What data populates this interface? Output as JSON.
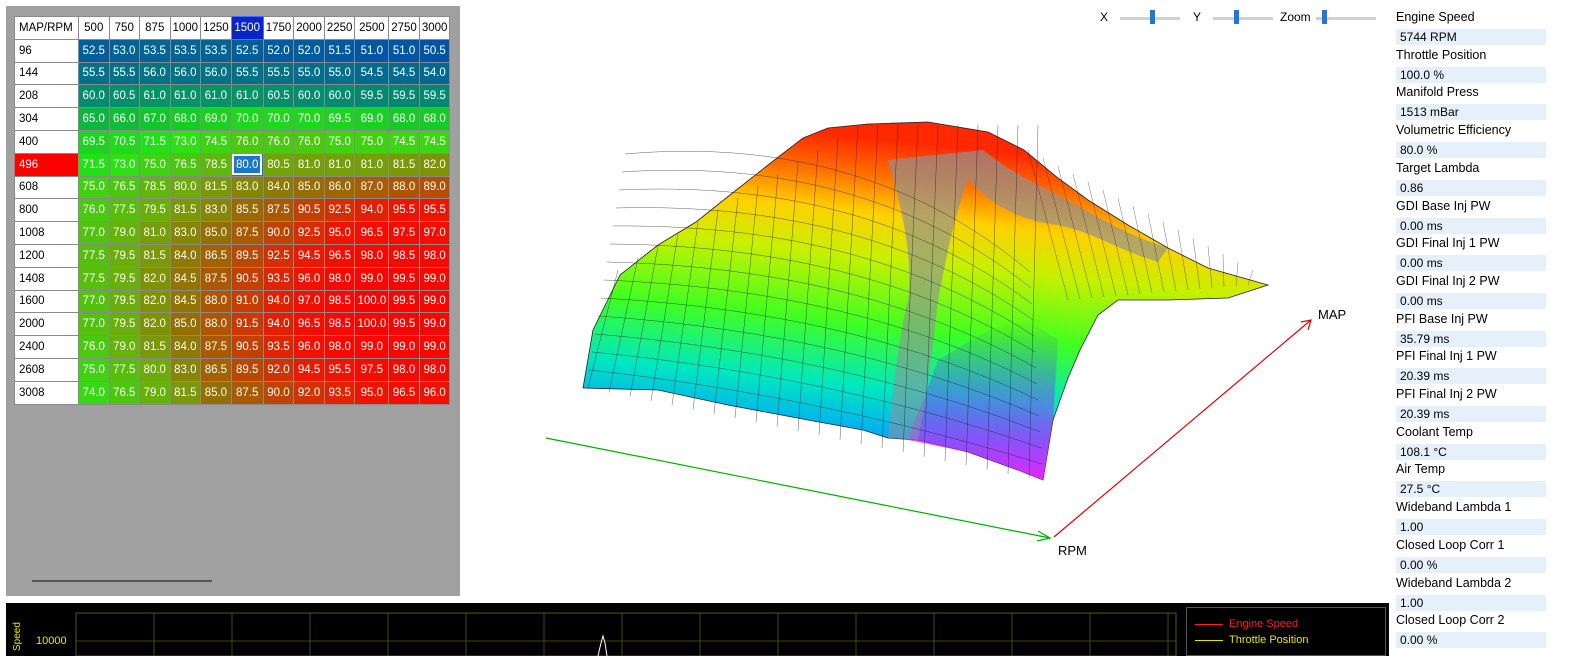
{
  "table": {
    "corner_label": "MAP/RPM",
    "rpm": [
      "500",
      "750",
      "875",
      "1000",
      "1250",
      "1500",
      "1750",
      "2000",
      "2250",
      "2500",
      "2750",
      "3000"
    ],
    "map": [
      "96",
      "144",
      "208",
      "304",
      "400",
      "496",
      "608",
      "800",
      "1008",
      "1200",
      "1408",
      "1600",
      "2000",
      "2400",
      "2608",
      "3008"
    ],
    "selected_col": 5,
    "selected_row": 5,
    "values": [
      [
        "52.5",
        "53.0",
        "53.5",
        "53.5",
        "53.5",
        "52.5",
        "52.0",
        "52.0",
        "51.5",
        "51.0",
        "51.0",
        "50.5"
      ],
      [
        "55.5",
        "55.5",
        "56.0",
        "56.0",
        "56.0",
        "55.5",
        "55.5",
        "55.0",
        "55.0",
        "54.5",
        "54.5",
        "54.0"
      ],
      [
        "60.0",
        "60.5",
        "61.0",
        "61.0",
        "61.0",
        "61.0",
        "60.5",
        "60.0",
        "60.0",
        "59.5",
        "59.5",
        "59.5"
      ],
      [
        "65.0",
        "66.0",
        "67.0",
        "68.0",
        "69.0",
        "70.0",
        "70.0",
        "70.0",
        "69.5",
        "69.0",
        "68.0",
        "68.0"
      ],
      [
        "69.5",
        "70.5",
        "71.5",
        "73.0",
        "74.5",
        "76.0",
        "76.0",
        "76.0",
        "75.0",
        "75.0",
        "74.5",
        "74.5"
      ],
      [
        "71.5",
        "73.0",
        "75.0",
        "76.5",
        "78.5",
        "80.0",
        "80.5",
        "81.0",
        "81.0",
        "81.0",
        "81.5",
        "82.0"
      ],
      [
        "75.0",
        "76.5",
        "78.5",
        "80.0",
        "81.5",
        "83.0",
        "84.0",
        "85.0",
        "86.0",
        "87.0",
        "88.0",
        "89.0"
      ],
      [
        "76.0",
        "77.5",
        "79.5",
        "81.5",
        "83.0",
        "85.5",
        "87.5",
        "90.5",
        "92.5",
        "94.0",
        "95.5",
        "95.5"
      ],
      [
        "77.0",
        "79.0",
        "81.0",
        "83.0",
        "85.0",
        "87.5",
        "90.0",
        "92.5",
        "95.0",
        "96.5",
        "97.5",
        "97.0"
      ],
      [
        "77.5",
        "79.5",
        "81.5",
        "84.0",
        "86.5",
        "89.5",
        "92.5",
        "94.5",
        "96.5",
        "98.0",
        "98.5",
        "98.0"
      ],
      [
        "77.5",
        "79.5",
        "82.0",
        "84.5",
        "87.5",
        "90.5",
        "93.5",
        "96.0",
        "98.0",
        "99.0",
        "99.5",
        "99.0"
      ],
      [
        "77.0",
        "79.5",
        "82.0",
        "84.5",
        "88.0",
        "91.0",
        "94.0",
        "97.0",
        "98.5",
        "100.0",
        "99.5",
        "99.0"
      ],
      [
        "77.0",
        "79.5",
        "82.0",
        "85.0",
        "88.0",
        "91.5",
        "94.0",
        "96.5",
        "98.5",
        "100.0",
        "99.5",
        "99.0"
      ],
      [
        "76.0",
        "79.0",
        "81.5",
        "84.0",
        "87.5",
        "90.5",
        "93.5",
        "96.0",
        "98.0",
        "99.0",
        "99.0",
        "99.0"
      ],
      [
        "75.0",
        "77.5",
        "80.0",
        "83.0",
        "86.5",
        "89.5",
        "92.0",
        "94.5",
        "95.5",
        "97.5",
        "98.0",
        "98.0"
      ],
      [
        "74.0",
        "76.5",
        "79.0",
        "81.5",
        "85.0",
        "87.5",
        "90.0",
        "92.0",
        "93.5",
        "95.0",
        "96.5",
        "96.0"
      ]
    ]
  },
  "controls": {
    "x_label": "X",
    "y_label": "Y",
    "zoom_label": "Zoom",
    "x_value": 0.5,
    "y_value": 0.35,
    "zoom_value": 0.1
  },
  "view3d": {
    "axis_rpm": "RPM",
    "axis_map": "MAP",
    "rpm_axis_color": "#00b000",
    "map_axis_color": "#e00000"
  },
  "params": [
    {
      "label": "Engine Speed",
      "value": "5744 RPM"
    },
    {
      "label": "Throttle Position",
      "value": "100.0 %"
    },
    {
      "label": "Manifold Press",
      "value": "1513 mBar"
    },
    {
      "label": "Volumetric Efficiency",
      "value": "80.0 %"
    },
    {
      "label": "Target Lambda",
      "value": "0.86"
    },
    {
      "label": "GDI Base Inj PW",
      "value": "0.00 ms"
    },
    {
      "label": "GDI Final Inj 1 PW",
      "value": "0.00 ms"
    },
    {
      "label": "GDI Final Inj 2 PW",
      "value": "0.00 ms"
    },
    {
      "label": "PFI Base Inj PW",
      "value": "35.79 ms"
    },
    {
      "label": "PFI Final Inj 1 PW",
      "value": "20.39 ms"
    },
    {
      "label": "PFI Final Inj 2 PW",
      "value": "20.39 ms"
    },
    {
      "label": "Coolant Temp",
      "value": "108.1 °C"
    },
    {
      "label": "Air Temp",
      "value": "27.5 °C"
    },
    {
      "label": "Wideband Lambda 1",
      "value": "1.00"
    },
    {
      "label": "Closed Loop Corr 1",
      "value": "0.00 %"
    },
    {
      "label": "Wideband Lambda 2",
      "value": "1.00"
    },
    {
      "label": "Closed Loop Corr 2",
      "value": "0.00 %"
    }
  ],
  "log": {
    "y_axis_label": "Speed",
    "y_tick": "10000",
    "legend": [
      {
        "name": "Engine Speed",
        "color": "#ff2020"
      },
      {
        "name": "Throttle Position",
        "color": "#e6e600"
      }
    ],
    "grid_color": "#5a5a00"
  }
}
